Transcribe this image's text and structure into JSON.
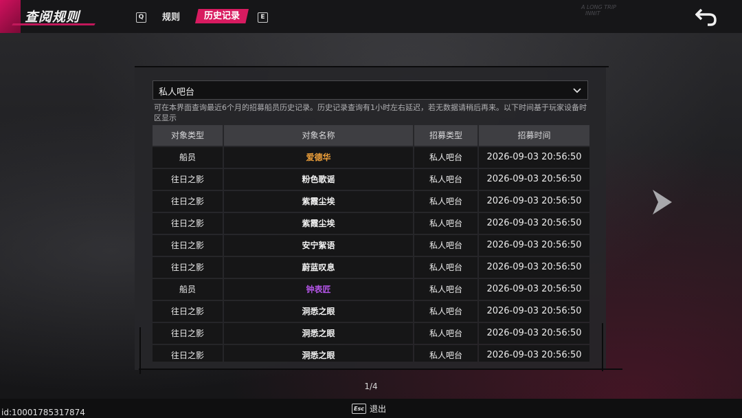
{
  "header": {
    "title": "查阅规则",
    "tabs": [
      {
        "key": "Q",
        "label": ""
      },
      {
        "label": "规则"
      },
      {
        "label": "历史记录",
        "active": true
      },
      {
        "key": "E",
        "label": ""
      }
    ],
    "watermark_line1": "A LONG TRIP",
    "watermark_line2": "INNIT"
  },
  "filter": {
    "selected": "私人吧台"
  },
  "notice": "可在本界面查询最近6个月的招募船员历史记录。历史记录查询有1小时左右延迟，若无数据请稍后再来。以下时间基于玩家设备时区显示",
  "table": {
    "headers": [
      "对象类型",
      "对象名称",
      "招募类型",
      "招募时间"
    ],
    "rows": [
      {
        "type": "船员",
        "name": "爱德华",
        "recruit": "私人吧台",
        "time": "2026-09-03 20:56:50",
        "name_color": "#f0a13a"
      },
      {
        "type": "往日之影",
        "name": "粉色歌谣",
        "recruit": "私人吧台",
        "time": "2026-09-03 20:56:50",
        "name_color": "#f2f2f2"
      },
      {
        "type": "往日之影",
        "name": "紫霞尘埃",
        "recruit": "私人吧台",
        "time": "2026-09-03 20:56:50",
        "name_color": "#f2f2f2"
      },
      {
        "type": "往日之影",
        "name": "紫霞尘埃",
        "recruit": "私人吧台",
        "time": "2026-09-03 20:56:50",
        "name_color": "#f2f2f2"
      },
      {
        "type": "往日之影",
        "name": "安宁絮语",
        "recruit": "私人吧台",
        "time": "2026-09-03 20:56:50",
        "name_color": "#f2f2f2"
      },
      {
        "type": "往日之影",
        "name": "蔚蓝叹息",
        "recruit": "私人吧台",
        "time": "2026-09-03 20:56:50",
        "name_color": "#f2f2f2"
      },
      {
        "type": "船员",
        "name": "钟表匠",
        "recruit": "私人吧台",
        "time": "2026-09-03 20:56:50",
        "name_color": "#b455e8"
      },
      {
        "type": "往日之影",
        "name": "洞悉之眼",
        "recruit": "私人吧台",
        "time": "2026-09-03 20:56:50",
        "name_color": "#f2f2f2"
      },
      {
        "type": "往日之影",
        "name": "洞悉之眼",
        "recruit": "私人吧台",
        "time": "2026-09-03 20:56:50",
        "name_color": "#f2f2f2"
      },
      {
        "type": "往日之影",
        "name": "洞悉之眼",
        "recruit": "私人吧台",
        "time": "2026-09-03 20:56:50",
        "name_color": "#f2f2f2"
      }
    ]
  },
  "pager": {
    "text": "1/4"
  },
  "footer": {
    "esc_key": "Esc",
    "exit_label": "退出",
    "uid": "id:10001785317874"
  },
  "colors": {
    "accent": "#d81b60",
    "legendary": "#f0a13a",
    "epic": "#b455e8"
  },
  "icons": {
    "back": "return-arrow-icon",
    "next": "chevron-right-icon",
    "dropdown": "chevron-down-icon"
  }
}
